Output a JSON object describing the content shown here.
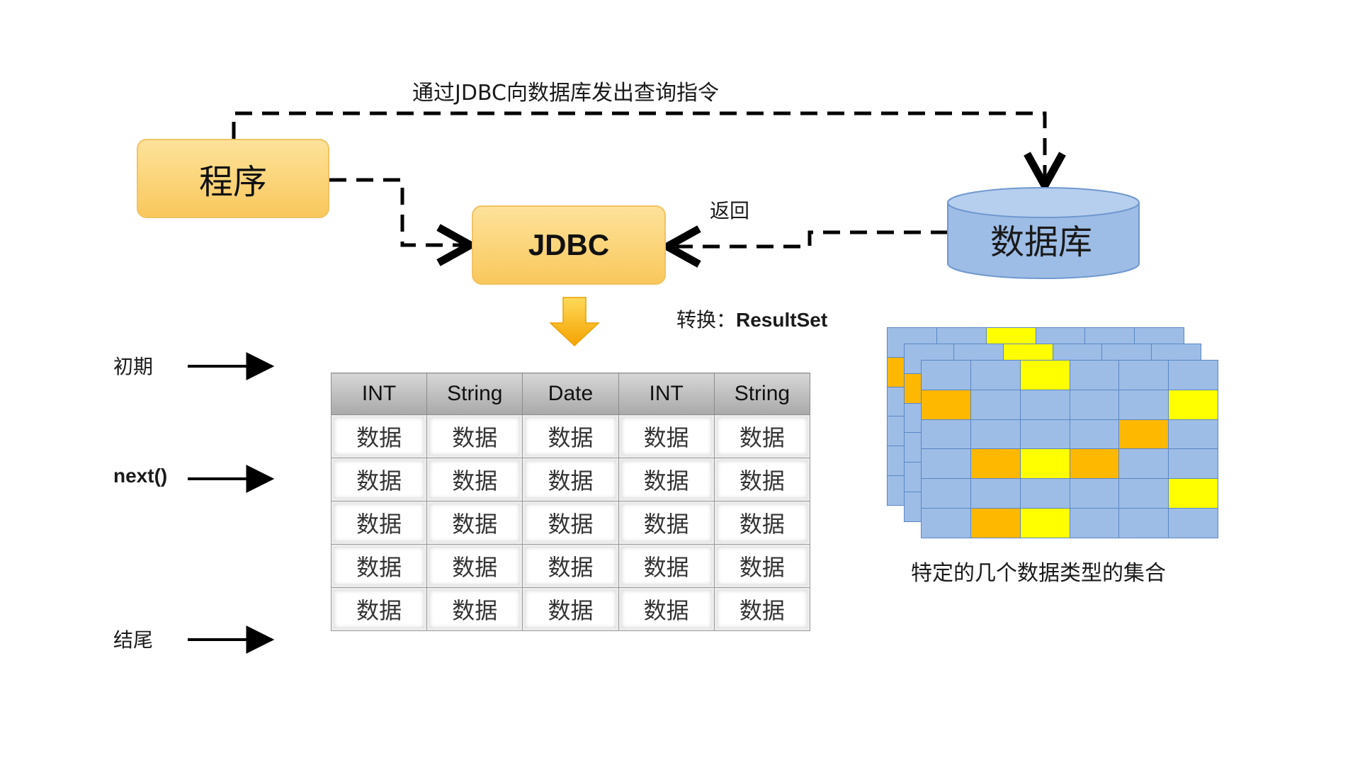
{
  "top_caption": "通过JDBC向数据库发出查询指令",
  "program_label": "程序",
  "jdbc_label": "JDBC",
  "database_label": "数据库",
  "return_label": "返回",
  "convert_label": "转换：",
  "convert_type": "ResultSet",
  "cursor_labels": {
    "start": "初期",
    "next": "next()",
    "end": "结尾"
  },
  "table": {
    "headers": [
      "INT",
      "String",
      "Date",
      "INT",
      "String"
    ],
    "rows": [
      [
        "数据",
        "数据",
        "数据",
        "数据",
        "数据"
      ],
      [
        "数据",
        "数据",
        "数据",
        "数据",
        "数据"
      ],
      [
        "数据",
        "数据",
        "数据",
        "数据",
        "数据"
      ],
      [
        "数据",
        "数据",
        "数据",
        "数据",
        "数据"
      ],
      [
        "数据",
        "数据",
        "数据",
        "数据",
        "数据"
      ]
    ]
  },
  "sets_caption": "特定的几个数据类型的集合",
  "colors": {
    "box_fill": "#f9c85c",
    "database_fill": "#9dbde6",
    "grid_cell": "#9dbde6",
    "highlight_orange": "#ffb800",
    "highlight_yellow": "#ffff00"
  }
}
